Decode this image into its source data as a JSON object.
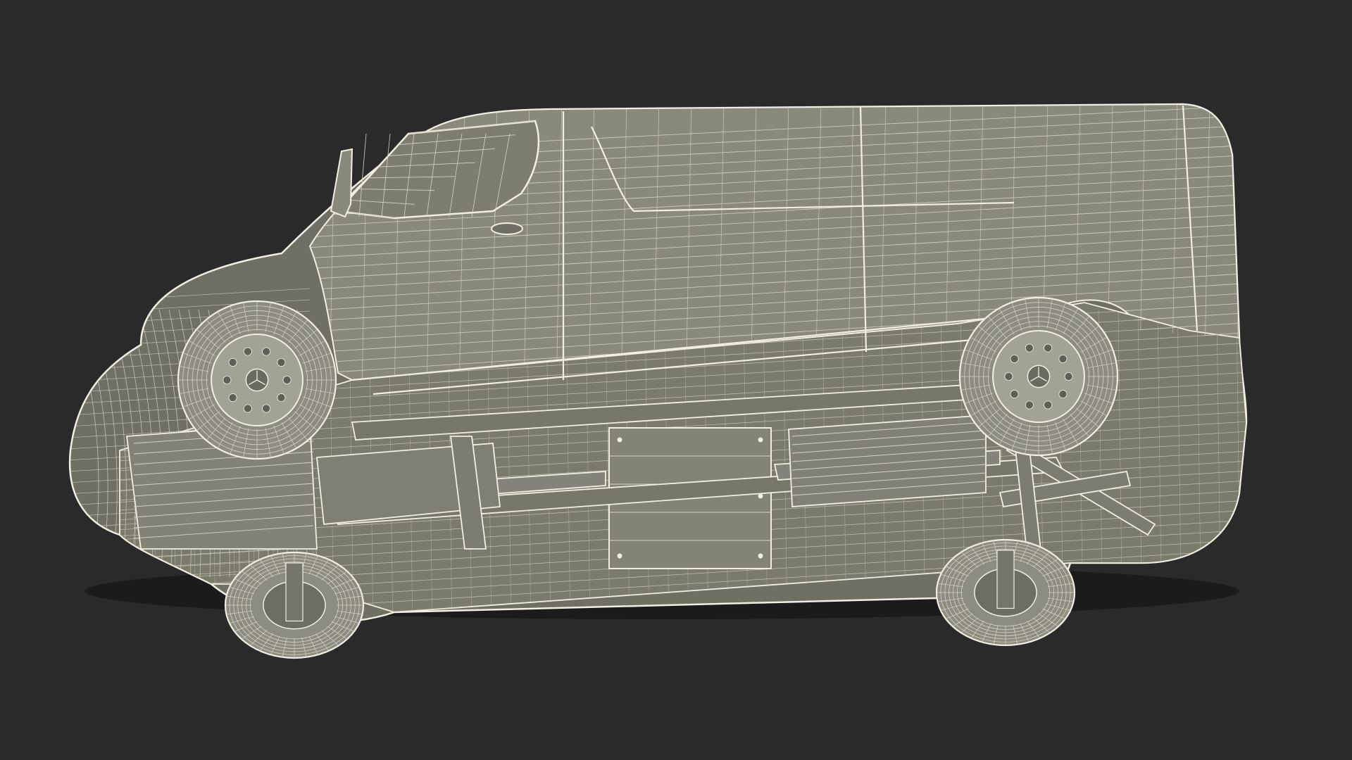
{
  "scene": {
    "subject": "van-wireframe-underside",
    "colors": {
      "background": "#2a2a2a",
      "body_fill": "#8a8a7c",
      "body_fill_dark": "#6f6f63",
      "underbody_fill": "#7a7a6d",
      "wire": "#f2efe2",
      "wire_dim": "#d8d4c4",
      "tire_fill": "#8c8c80",
      "rim_fill": "#a2a295",
      "shadow": "#55554c"
    }
  }
}
